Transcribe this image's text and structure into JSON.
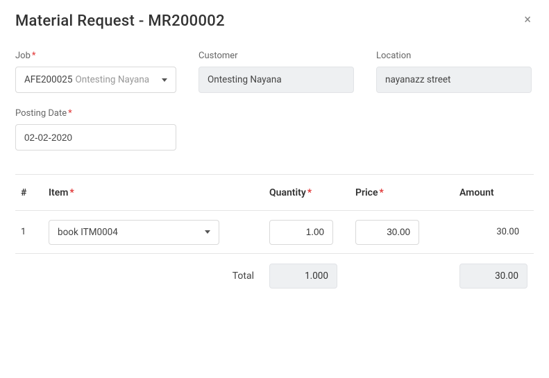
{
  "header": {
    "title": "Material Request - MR200002"
  },
  "form": {
    "job": {
      "label": "Job",
      "required": true,
      "code": "AFE200025",
      "desc": "Ontesting Nayana"
    },
    "customer": {
      "label": "Customer",
      "value": "Ontesting Nayana"
    },
    "location": {
      "label": "Location",
      "value": "nayanazz street"
    },
    "posting_date": {
      "label": "Posting Date",
      "required": true,
      "value": "02-02-2020"
    }
  },
  "table": {
    "headers": {
      "idx": "#",
      "item": "Item",
      "qty": "Quantity",
      "price": "Price",
      "amount": "Amount"
    },
    "rows": [
      {
        "idx": "1",
        "item": {
          "name": "book",
          "code": "ITM0004"
        },
        "qty": "1.00",
        "price": "30.00",
        "amount": "30.00"
      }
    ],
    "totals": {
      "label": "Total",
      "qty": "1.000",
      "amount": "30.00"
    }
  }
}
